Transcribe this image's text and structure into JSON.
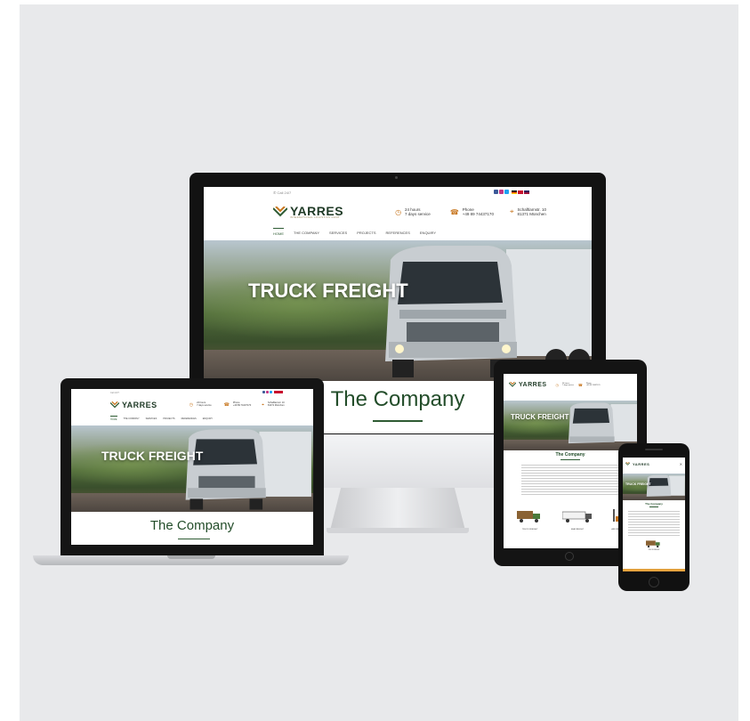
{
  "site": {
    "phone_top": "Call 24/7",
    "logo_text": "YARRES",
    "logo_tag": "INTERNATIONAL LOGISTICS GmbH",
    "info": [
      {
        "icon": "clock-icon",
        "line1": "24 hours",
        "line2": "7 days service"
      },
      {
        "icon": "phone-icon",
        "line1": "Phone",
        "line2": "+49 89 74437170"
      },
      {
        "icon": "location-icon",
        "line1": "Schaftlarnstr. 10",
        "line2": "81371 München"
      }
    ],
    "nav": [
      "HOME",
      "THE COMPANY",
      "SERVICES",
      "PROJECTS",
      "REFERENCES",
      "ENQUIRY"
    ],
    "hero_title": "TRUCK FREIGHT",
    "section_title": "The Company",
    "services": [
      "TRUCK FREIGHT",
      "SEA FREIGHT",
      "AIR FREIGHT"
    ]
  },
  "colors": {
    "brand_green": "#234d2a",
    "accent_orange": "#c7761f",
    "background": "#e8e9eb"
  }
}
